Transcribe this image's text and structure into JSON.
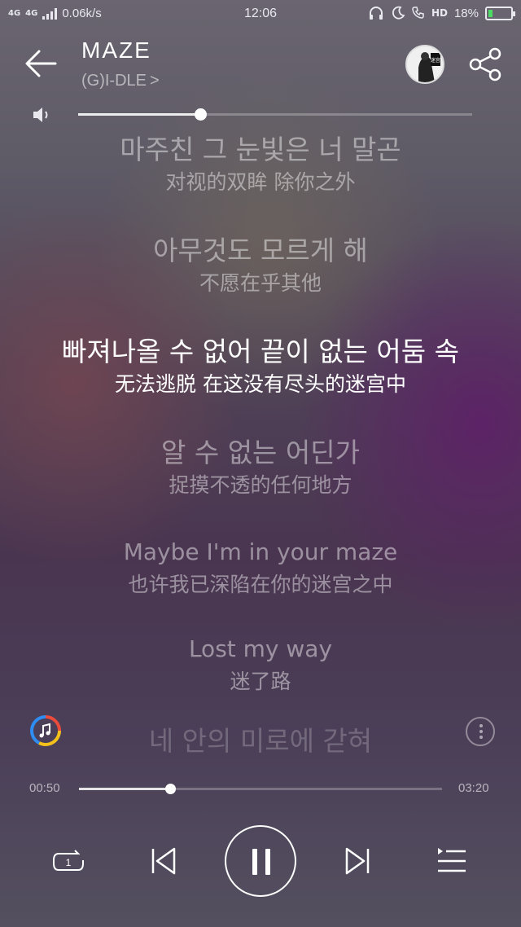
{
  "status_bar": {
    "network_primary": "4G",
    "network_secondary": "4G",
    "speed": "0.06k/s",
    "time": "12:06",
    "hd": "HD",
    "battery": "18%",
    "battery_level": 0.18
  },
  "header": {
    "title": "MAZE",
    "artist": "(G)I-DLE",
    "artist_chevron": ">",
    "album_thumb_text": "迷宫"
  },
  "volume": {
    "level": 0.31
  },
  "lyrics": [
    {
      "orig": "마주친 그 눈빛은 너 말곤",
      "trans": "对视的双眸 除你之外",
      "state": "dim"
    },
    {
      "orig": "아무것도 모르게 해",
      "trans": "不愿在乎其他",
      "state": "dim"
    },
    {
      "orig": "빠져나올 수 없어 끝이 없는 어둠 속",
      "trans": "无法逃脱 在这没有尽头的迷宫中",
      "state": "active"
    },
    {
      "orig": "알 수 없는 어딘가",
      "trans": "捉摸不透的任何地方",
      "state": "dim"
    },
    {
      "orig": "Maybe I'm in your maze",
      "trans": "也许我已深陷在你的迷宫之中",
      "state": "dim"
    },
    {
      "orig": "Lost my way",
      "trans": "迷了路",
      "state": "dim"
    },
    {
      "orig": "네 안의 미로에 갇혀",
      "trans": "",
      "state": "faded"
    }
  ],
  "progress": {
    "current": "00:50",
    "total": "03:20",
    "fraction": 0.25
  },
  "colors": {
    "accent": "#ffffff",
    "battery_fill": "#4cd964",
    "ring_blue": "#2f8cf0",
    "ring_red": "#e94b3c",
    "ring_yellow": "#f5c11b"
  }
}
